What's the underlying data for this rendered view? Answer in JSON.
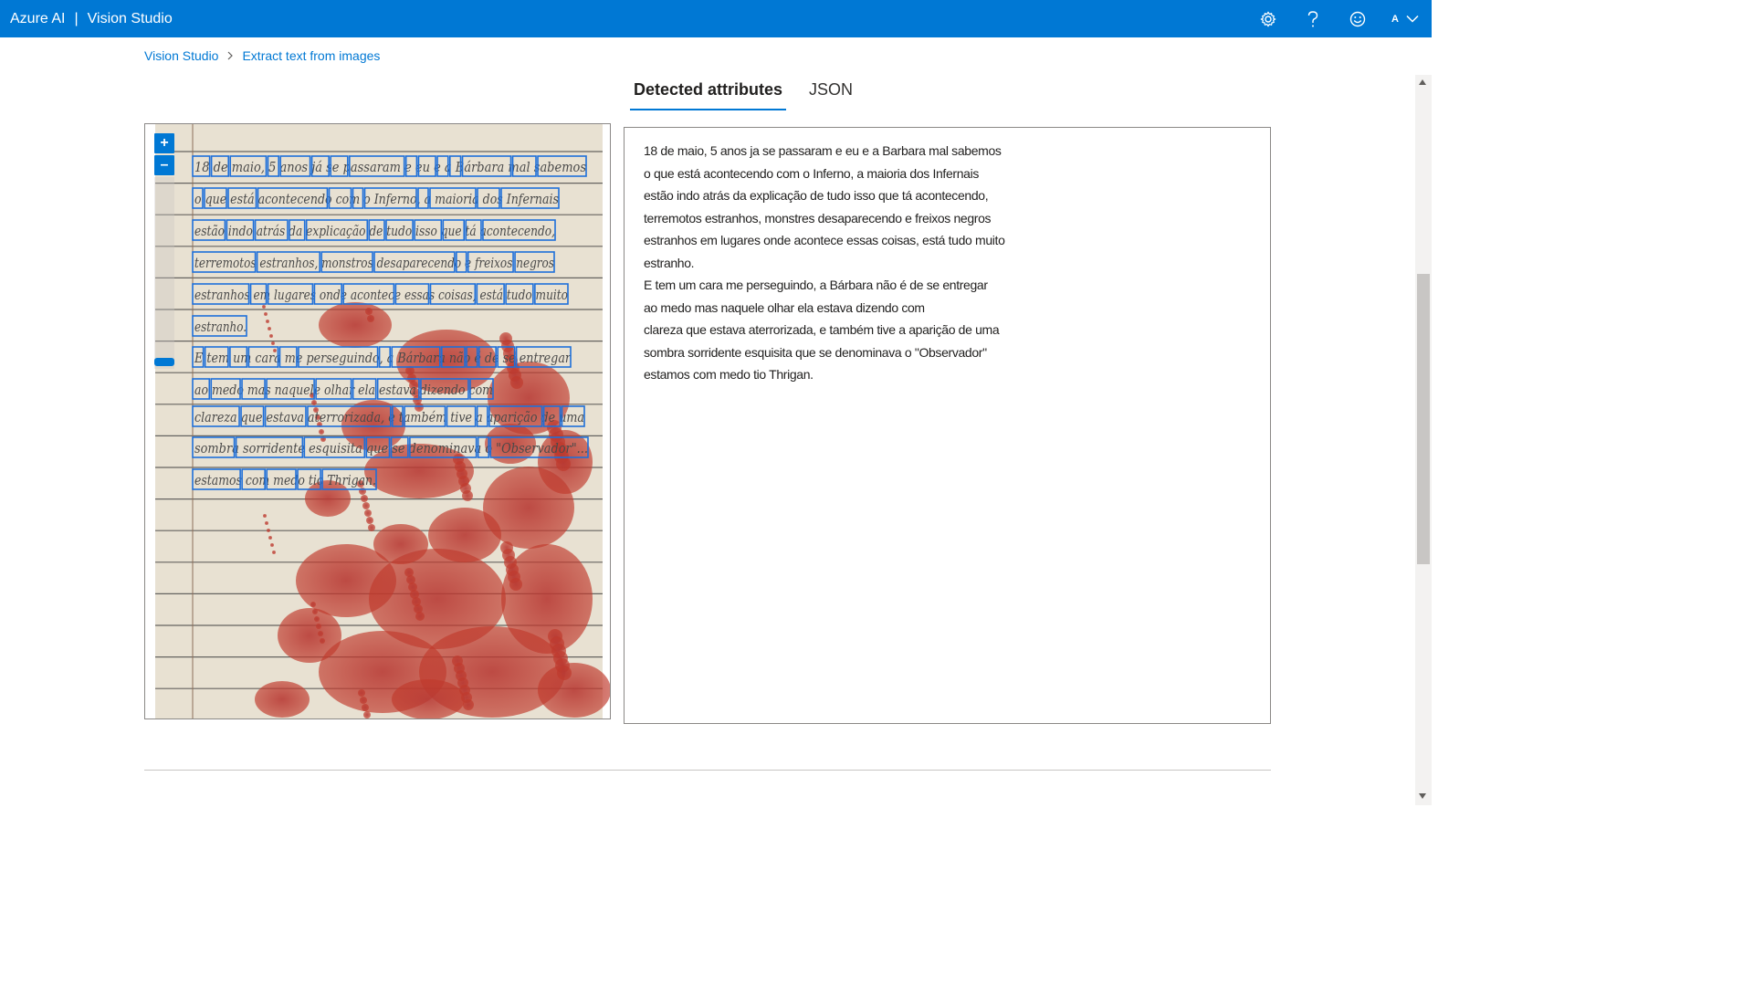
{
  "header": {
    "brand": "Azure AI",
    "separator": "|",
    "product": "Vision Studio",
    "avatar_initial": "A",
    "icons": [
      "gear-icon",
      "help-icon",
      "smiley-icon",
      "chevron-down-icon"
    ]
  },
  "breadcrumb": {
    "items": [
      "Vision Studio",
      "Extract text from images"
    ]
  },
  "tabs": [
    {
      "label": "Detected attributes",
      "active": true
    },
    {
      "label": "JSON",
      "active": false
    }
  ],
  "image_viewer": {
    "zoom_in": "+",
    "zoom_out": "–",
    "zoom_level": 0.1,
    "handwritten_lines": [
      "18 de maio, 5 anos já se passaram e eu e a Bárbara mal sabemos",
      "o que está acontecendo com o Inferno, a maioria dos Infernais",
      "estão indo atrás da explicação de tudo isso que tá acontecendo,",
      "terremotos estranhos, monstros desaparecendo e freixos negros",
      "estranhos em lugares onde acontece essas coisas, está tudo muito",
      "estranho.",
      "E tem um cara me perseguindo, a Bárbara não é de se entregar",
      "ao medo mas naquele olhar ela estava dizendo com",
      "clareza que estava aterrorizada, e também tive a aparição de uma",
      "sombra sorridente esquisita que se denominava o \"Observador\"...",
      "estamos com medo tio Thrigan."
    ]
  },
  "result": {
    "lines": [
      "18 de maio, 5 anos ja se passaram e eu e a Barbara mal sabemos",
      "o que está acontecendo com o Inferno, a maioria dos Infernais",
      "estão indo atrás da explicação de tudo isso que tá acontecendo,",
      "terremotos estranhos, monstres desaparecendo e freixos negros",
      "estranhos em lugares onde acontece essas coisas, está tudo muito",
      "estranho.",
      "E tem um cara me perseguindo, a Bárbara não é de se entregar",
      "ao medo mas naquele olhar ela estava dizendo com",
      "clareza que estava aterrorizada, e também tive a aparição de uma",
      "sombra sorridente esquisita que se denominava o \"Observador\"",
      "estamos com medo tio Thrigan."
    ]
  },
  "colors": {
    "accent": "#0078d4",
    "bounding_box": "#1e6fd9",
    "paper": "#e9e2d3",
    "stain": "#c0392b"
  }
}
